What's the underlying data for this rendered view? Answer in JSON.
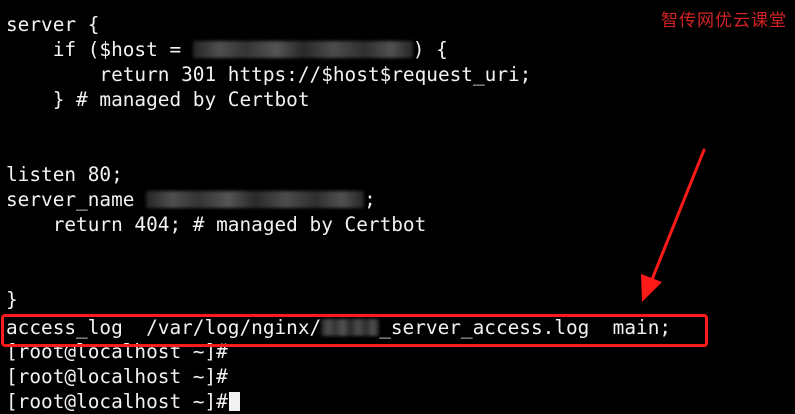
{
  "watermark": "智传网优云课堂",
  "lines": {
    "l1": "server {",
    "l2_pre": "    if ($host = ",
    "l2_post": ") {",
    "l3": "        return 301 https://$host$request_uri;",
    "l4": "    } # managed by Certbot",
    "l5": "listen 80;",
    "l6_pre": "server_name ",
    "l6_post": ";",
    "l7": "    return 404; # managed by Certbot",
    "l8": "}",
    "l9_pre": "access_log  /var/log/nginx/",
    "l9_post": "_server_access.log  main;",
    "prompt": "[root@localhost ~]#"
  },
  "colors": {
    "background": "#000000",
    "text": "#f2f2f2",
    "annotation": "#ff1a1a"
  }
}
